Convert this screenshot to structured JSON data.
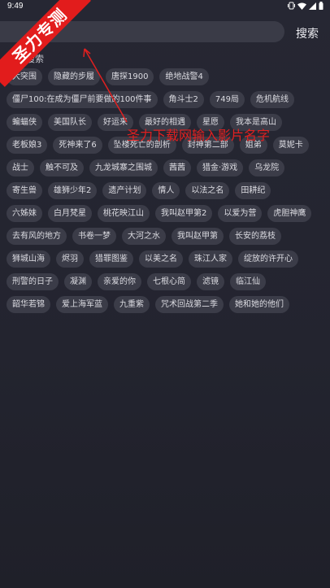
{
  "status_bar": {
    "time": "9:49",
    "icons": [
      "vibrate-icon",
      "wifi-icon",
      "signal-icon",
      "battery-icon"
    ]
  },
  "search": {
    "placeholder": "",
    "value": "",
    "button_label": "搜索"
  },
  "section": {
    "title": "热门搜索",
    "title_visible": "搜索"
  },
  "tags": [
    [
      "大突围",
      "隐藏的步履",
      "唐探1900",
      "绝地战警4"
    ],
    [
      "僵尸100:在成为僵尸前要做的100件事",
      "角斗士2",
      "749局",
      "危机航线"
    ],
    [
      "蝙蝠侠",
      "美国队长",
      "好运来",
      "最好的相遇",
      "星愿",
      "我本是高山"
    ],
    [
      "老板娘3",
      "死神来了6",
      "坠楼死亡的剖析",
      "封神第二部",
      "姐弟",
      "莫妮卡"
    ],
    [
      "战士",
      "触不可及",
      "九龙城寨之围城",
      "茜茜",
      "猎金·游戏",
      "乌龙院"
    ],
    [
      "寄生兽",
      "雄狮少年2",
      "遗产计划",
      "情人",
      "以法之名",
      "田耕纪"
    ],
    [
      "六姊妹",
      "白月梵星",
      "桃花映江山",
      "我叫赵甲第2",
      "以爱为营",
      "虎胆神鹰"
    ],
    [
      "去有风的地方",
      "书卷一梦",
      "大河之水",
      "我叫赵甲第",
      "长安的荔枝"
    ],
    [
      "狮城山海",
      "烬羽",
      "猎罪图鉴",
      "以美之名",
      "珠江人家",
      "绽放的许开心"
    ],
    [
      "刑警的日子",
      "凝渊",
      "亲爱的你",
      "七根心简",
      "滤镜",
      "临江仙"
    ],
    [
      "韶华若锦",
      "爱上海军蓝",
      "九重紫",
      "咒术回战第二季",
      "她和她的他们"
    ]
  ],
  "overlay": {
    "banner_text": "圣力专测",
    "annotation_text": "圣力下载网输入影片名字",
    "color": "#e02020"
  },
  "colors": {
    "background": "#23242f",
    "tag_background": "#3b3c48",
    "search_background": "#3a3b47",
    "accent_red": "#e21c1c"
  }
}
